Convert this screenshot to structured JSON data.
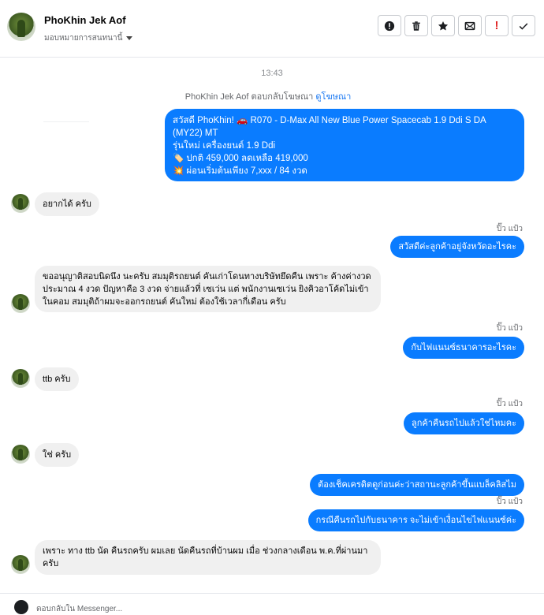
{
  "header": {
    "name": "PhoKhin Jek Aof",
    "subtitle": "มอบหมายการสนทนานี้",
    "actions": [
      {
        "name": "alert-button",
        "icon": "alert-circle-icon"
      },
      {
        "name": "delete-button",
        "icon": "trash-icon"
      },
      {
        "name": "star-button",
        "icon": "star-icon"
      },
      {
        "name": "mark-unread-button",
        "icon": "envelope-icon"
      },
      {
        "name": "spam-button",
        "icon": "exclamation-icon",
        "label": "!"
      },
      {
        "name": "done-button",
        "icon": "check-icon"
      }
    ]
  },
  "thread": {
    "time": "13:43",
    "reply_note": "PhoKhin Jek Aof ตอบกลับโฆษณา",
    "reply_note_link": "ดูโฆษณา",
    "ad_card": {
      "line1": "สวัสดี PhoKhin! 🚗 R070 - D-Max All New Blue Power Spacecab 1.9 Ddi S DA",
      "line2": "(MY22) MT",
      "line3": "รุ่นใหม่ เครื่องยนต์ 1.9 Ddi",
      "line4": "ปกติ 459,000 ลดเหลือ 419,000",
      "line5": "ผ่อนเริ่มต้นเพียง 7,xxx / 84 งวด",
      "emoji_tag": "🏷️",
      "emoji_burst": "💥"
    },
    "messages": [
      {
        "side": "in",
        "text": "อยากได้ ครับ"
      },
      {
        "side": "out",
        "sender": "ปิ๊ว แป้ว",
        "text": "สวัสดีค่ะลูกค้าอยู่จังหวัดอะไรคะ"
      },
      {
        "side": "in",
        "text": "ขออนุญาติสอบนิดนึง นะครับ สมมุติรถยนต์ คันเก่าโดนทางบริษัทยึดคืน เพราะ ค้างค่างวด ประมาณ 4  งวด ปัญหาคือ 3  งวด จ่ายแล้วที่ เซเว่น แต่ พนักงานเซเว่น ยิงคิวอาโค้ดไม่เข้าในคอม สมมุติถ้าผมจะออกรถยนต์ คันใหม่ ต้องใช้เวลากี่เดือน ครับ"
      },
      {
        "side": "out",
        "sender": "ปิ๊ว แป้ว",
        "text": "กับไฟแนนซ์ธนาคารอะไรคะ"
      },
      {
        "side": "in",
        "text": "ttb ครับ"
      },
      {
        "side": "out",
        "sender": "ปิ๊ว แป้ว",
        "text": "ลูกค้าคืนรถไปแล้วใช่ไหมคะ"
      },
      {
        "side": "in",
        "text": "ใช่ ครับ"
      },
      {
        "side": "out",
        "text": "ต้องเช็คเครดิตดูก่อนค่ะว่าสถานะลูกค้าขึ้นแบล็คลิสไม"
      },
      {
        "side": "out",
        "sender": "ปิ๊ว แป้ว",
        "text": "กรณีคืนรถไปกับธนาคาร จะไม่เข้าเงื่อนไขไฟแนนซ์ค่ะ"
      },
      {
        "side": "in",
        "text": "เพราะ ทาง ttb นัด คืนรถครับ ผมเลย นัดคืนรถที่บ้านผม เมื่อ ช่วงกลางเดือน พ.ค.ที่ผ่านมาครับ"
      }
    ]
  },
  "footer": {
    "placeholder": "ตอบกลับใน Messenger..."
  }
}
